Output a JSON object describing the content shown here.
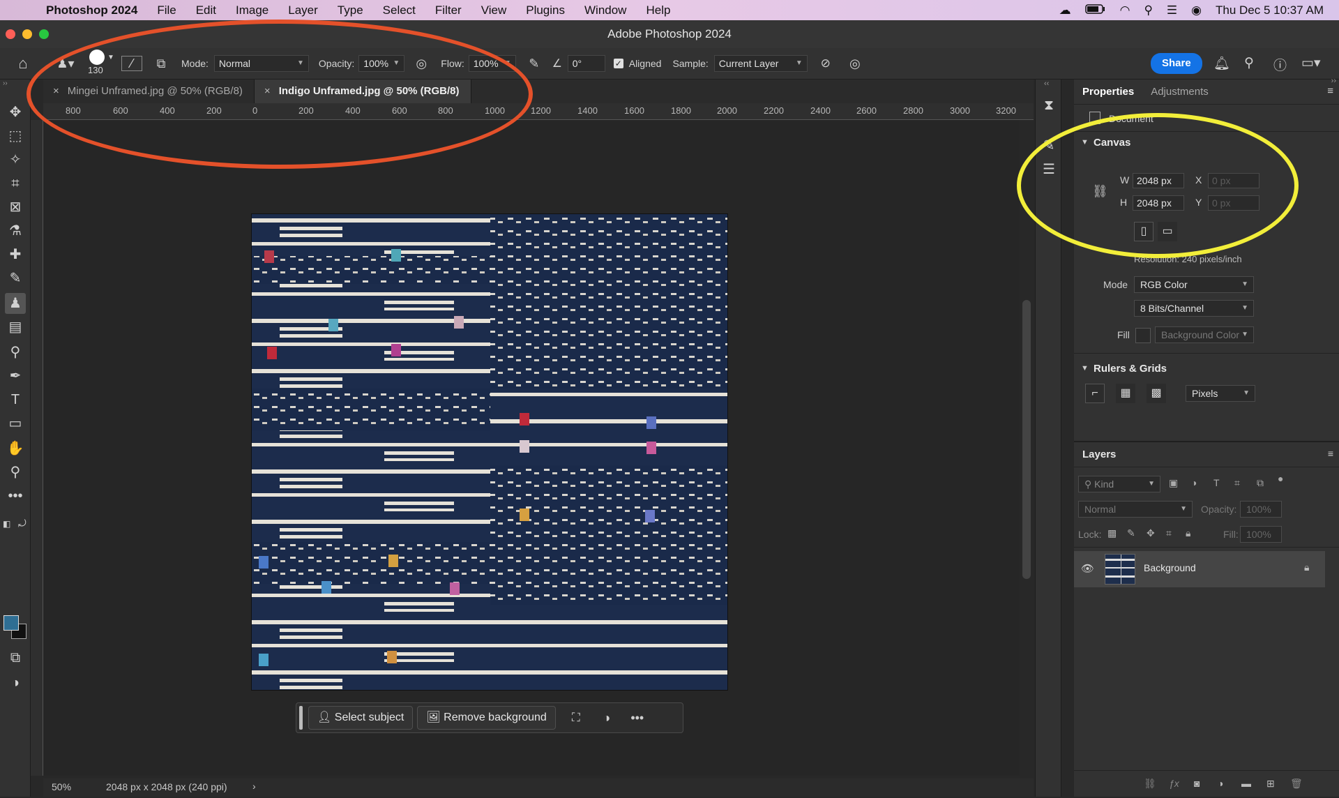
{
  "menubar": {
    "app": "Photoshop 2024",
    "items": [
      "File",
      "Edit",
      "Image",
      "Layer",
      "Type",
      "Select",
      "Filter",
      "View",
      "Plugins",
      "Window",
      "Help"
    ],
    "datetime": "Thu Dec 5  10:37 AM"
  },
  "window": {
    "title": "Adobe Photoshop 2024"
  },
  "options": {
    "brush_size": "130",
    "mode_label": "Mode:",
    "mode_value": "Normal",
    "opacity_label": "Opacity:",
    "opacity_value": "100%",
    "flow_label": "Flow:",
    "flow_value": "100%",
    "angle_value": "0°",
    "aligned_label": "Aligned",
    "sample_label": "Sample:",
    "sample_value": "Current Layer",
    "share_label": "Share"
  },
  "tabs": [
    {
      "label": "Mingei Unframed.jpg @ 50% (RGB/8)",
      "active": false
    },
    {
      "label": "Indigo Unframed.jpg @ 50% (RGB/8)",
      "active": true
    }
  ],
  "ruler": {
    "h_labels": [
      "800",
      "600",
      "400",
      "200",
      "0",
      "200",
      "400",
      "600",
      "800",
      "1000",
      "1200",
      "1400",
      "1600",
      "1800",
      "2000",
      "2200",
      "2400",
      "2600",
      "2800",
      "3000",
      "3200"
    ]
  },
  "context_bar": {
    "select_subject": "Select subject",
    "remove_background": "Remove background"
  },
  "status": {
    "zoom": "50%",
    "doc_info": "2048 px x 2048 px (240 ppi)"
  },
  "properties": {
    "tab_properties": "Properties",
    "tab_adjustments": "Adjustments",
    "document_label": "Document",
    "canvas_header": "Canvas",
    "w_label": "W",
    "w_value": "2048 px",
    "h_label": "H",
    "h_value": "2048 px",
    "x_label": "X",
    "x_placeholder": "0 px",
    "y_label": "Y",
    "y_placeholder": "0 px",
    "resolution": "Resolution: 240 pixels/inch",
    "mode_label": "Mode",
    "mode_value": "RGB Color",
    "bits_value": "8 Bits/Channel",
    "fill_label": "Fill",
    "fill_value": "Background Color",
    "rulers_header": "Rulers & Grids",
    "units_value": "Pixels"
  },
  "layers": {
    "title": "Layers",
    "kind_placeholder": "Kind",
    "blend_mode": "Normal",
    "opacity_label": "Opacity:",
    "opacity_value": "100%",
    "lock_label": "Lock:",
    "fill_label": "Fill:",
    "fill_value": "100%",
    "items": [
      {
        "name": "Background",
        "visible": true,
        "locked": true
      }
    ]
  },
  "colors": {
    "accent": "#1473e6",
    "annotation_red": "#e4512a",
    "annotation_yellow": "#f2ee3a",
    "foreground_swatch": "#2f6e93"
  }
}
